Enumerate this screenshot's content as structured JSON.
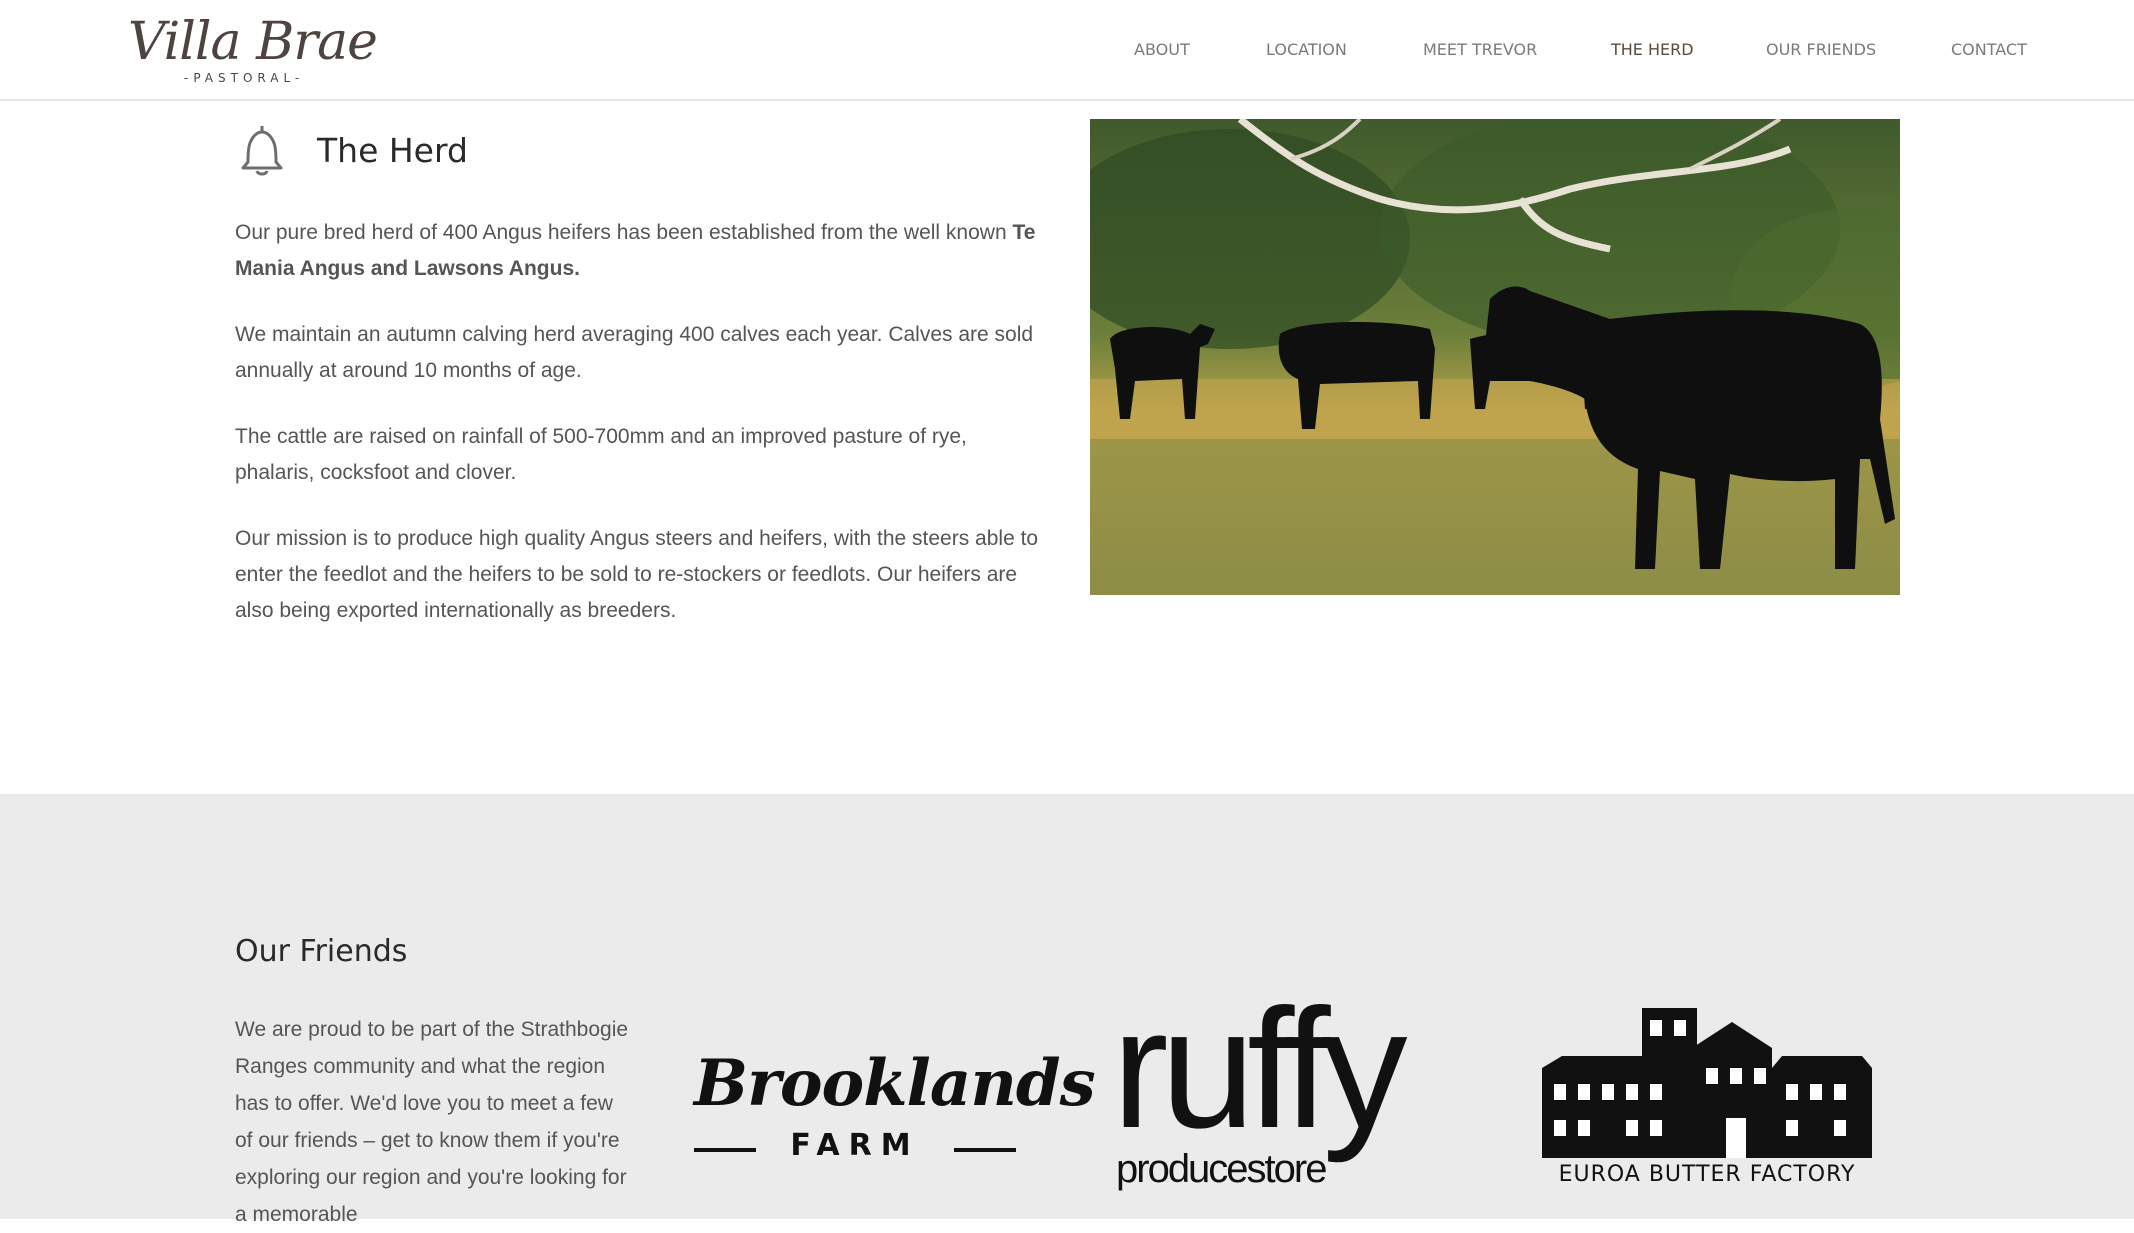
{
  "header": {
    "logo_text": "Villa Brae",
    "logo_sub": "-PASTORAL-",
    "nav": [
      {
        "label": "ABOUT"
      },
      {
        "label": "LOCATION"
      },
      {
        "label": "MEET TREVOR"
      },
      {
        "label": "THE HERD",
        "active": true
      },
      {
        "label": "OUR FRIENDS"
      },
      {
        "label": "CONTACT"
      }
    ]
  },
  "herd": {
    "title": "The Herd",
    "p1_text": "Our pure bred herd of 400 Angus heifers has been established from the well known ",
    "p1_bold": "Te Mania Angus and Lawsons Angus.",
    "p2": "We maintain an autumn calving herd averaging 400 calves each year. Calves are sold annually at around 10 months of age.",
    "p3": "The cattle are raised on rainfall of 500-700mm and an improved pasture of rye, phalaris, cocksfoot and clover.",
    "p4": "Our mission is to produce high quality Angus steers and heifers, with the steers able to enter the feedlot and the heifers to be sold to re-stockers or feedlots. Our heifers are also being exported internationally as breeders.",
    "icon": "bell-icon"
  },
  "friends": {
    "title": "Our Friends",
    "text": "We are proud to be part of the Strathbogie Ranges community and what the region has to offer. We'd love you to meet a few of our friends – get to know them if you're exploring our region and you're looking for a memorable",
    "brands": {
      "brooklands": {
        "script": "Brooklands",
        "sub": "FARM"
      },
      "ruffy": {
        "main": "ruffy",
        "sub": "producestore"
      },
      "euroa": {
        "text": "EUROA BUTTER FACTORY"
      }
    }
  },
  "colors": {
    "logo": "#4e4340",
    "nav": "#7a7a7a",
    "nav_active": "#5b4a3a",
    "friends_bg": "#ebebeb"
  }
}
